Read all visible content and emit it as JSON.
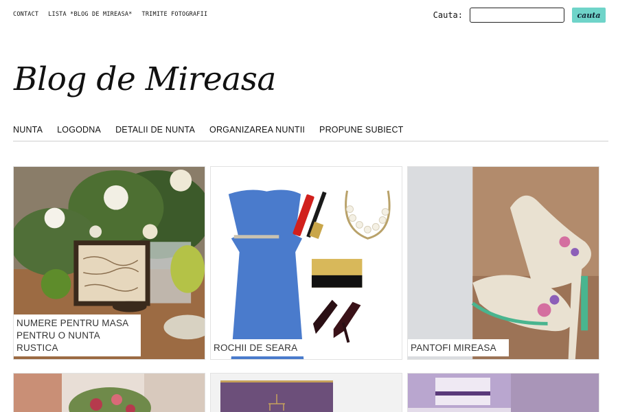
{
  "toplinks": [
    "CONTACT",
    "LISTA *BLOG DE MIREASA*",
    "TRIMITE FOTOGRAFII"
  ],
  "search": {
    "label": "Cauta:",
    "value": "",
    "button": "cauta"
  },
  "site_title": "Blog de Mireasa",
  "mainnav": [
    "NUNTA",
    "LOGODNA",
    "DETALII DE NUNTA",
    "ORGANIZAREA NUNTII",
    "PROPUNE SUBIECT"
  ],
  "posts": [
    {
      "caption_lines": [
        "NUMERE PENTRU MASA",
        "PENTRU O NUNTA",
        "RUSTICA"
      ]
    },
    {
      "caption_lines": [
        "ROCHII DE SEARA"
      ]
    },
    {
      "caption_lines": [
        "PANTOFI MIREASA"
      ]
    }
  ],
  "colors": {
    "accent": "#6fd4c9",
    "rule": "#cfcfcf"
  }
}
